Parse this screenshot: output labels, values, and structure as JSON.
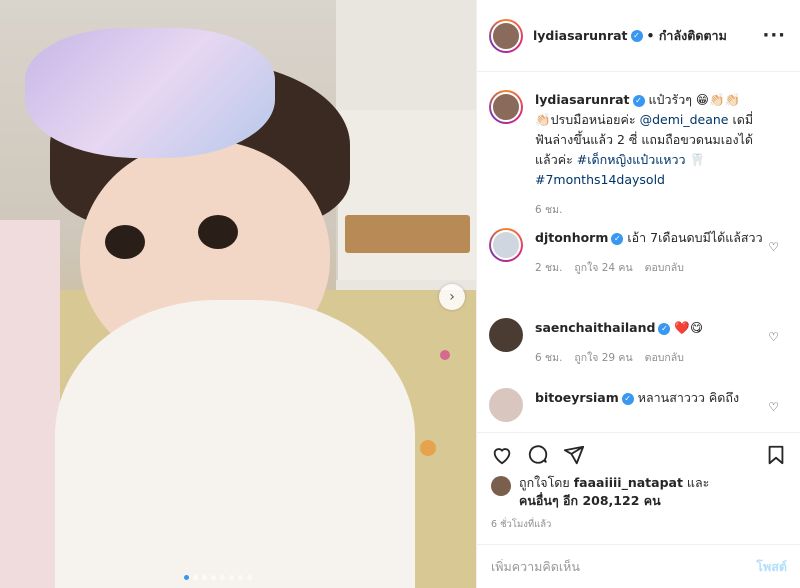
{
  "colors": {
    "accent": "#3897f0",
    "link": "#003569",
    "muted": "#8e8e8e",
    "post_disabled": "#b2dffc"
  },
  "icons": {
    "verified": "verified-badge-icon",
    "more": "more-options-icon",
    "heart": "heart-icon",
    "comment": "comment-icon",
    "share": "share-icon",
    "save": "bookmark-icon",
    "next": "chevron-right-icon"
  },
  "header": {
    "username": "lydiasarunrat",
    "follow_label": "• กำลังติดตาม",
    "more": "···"
  },
  "media": {
    "next_glyph": "›",
    "slide_count": 8,
    "active_slide": 1
  },
  "caption": {
    "username": "lydiasarunrat",
    "text_1": "แป๋วรัวๆ 😁👏🏻👏🏻",
    "text_2": "👏🏻ปรบมือหน่อยค่ะ ",
    "mention": "@demi_deane",
    "text_3": " เดมี่ฟันล่างขึ้นแล้ว 2 ซี่ แถมถือขวดนมเองได้แล้วค่ะ ",
    "hashtag_1": "#เด็กหญิงแป๋วแหวว",
    "tooth": " 🦷",
    "hashtag_2": "#7months14daysold",
    "time": "6 ชม."
  },
  "comments": [
    {
      "username": "djtonhorm",
      "text": " เอ้า 7เดือนดบมีได้แล้สวว",
      "time": "2 ชม.",
      "likes": "ถูกใจ 24 คน",
      "reply": "ตอบกลับ"
    },
    {
      "username": "saenchaithailand",
      "text": " ❤️😋",
      "time": "6 ชม.",
      "likes": "ถูกใจ 29 คน",
      "reply": "ตอบกลับ"
    },
    {
      "username": "bitoeyrsiam",
      "text": " หลานสาววว คิดถึง",
      "time": "",
      "likes": "",
      "reply": ""
    }
  ],
  "likes": {
    "prefix": "ถูกใจโดย ",
    "user": "faaaiiii_natapat",
    "suffix": " และ",
    "others": "คนอื่นๆ อีก 208,122 คน"
  },
  "timestamp": "6 ชั่วโมงที่แล้ว",
  "add_comment": {
    "placeholder": "เพิ่มความคิดเห็น",
    "post_label": "โพสต์"
  }
}
